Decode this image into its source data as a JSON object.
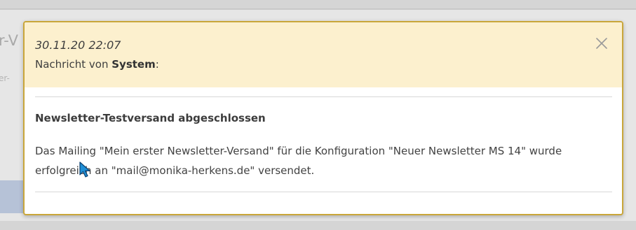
{
  "background": {
    "title_fragment": "r-V",
    "subtitle_fragment": "er-"
  },
  "notification": {
    "timestamp": "30.11.20 22:07",
    "from_prefix": "Nachricht von ",
    "sender": "System",
    "from_suffix": ":",
    "title": "Newsletter-Testversand abgeschlossen",
    "body": "Das Mailing \"Mein erster Newsletter-Versand\" für die Konfiguration \"Neuer Newsletter MS 14\" wurde erfolgreich an \"mail@monika-herkens.de\" versendet.",
    "close_icon": "close-icon"
  },
  "colors": {
    "header_bg": "#fcf0ce",
    "border": "#c9a63a",
    "cursor": "#1f8fd6"
  }
}
